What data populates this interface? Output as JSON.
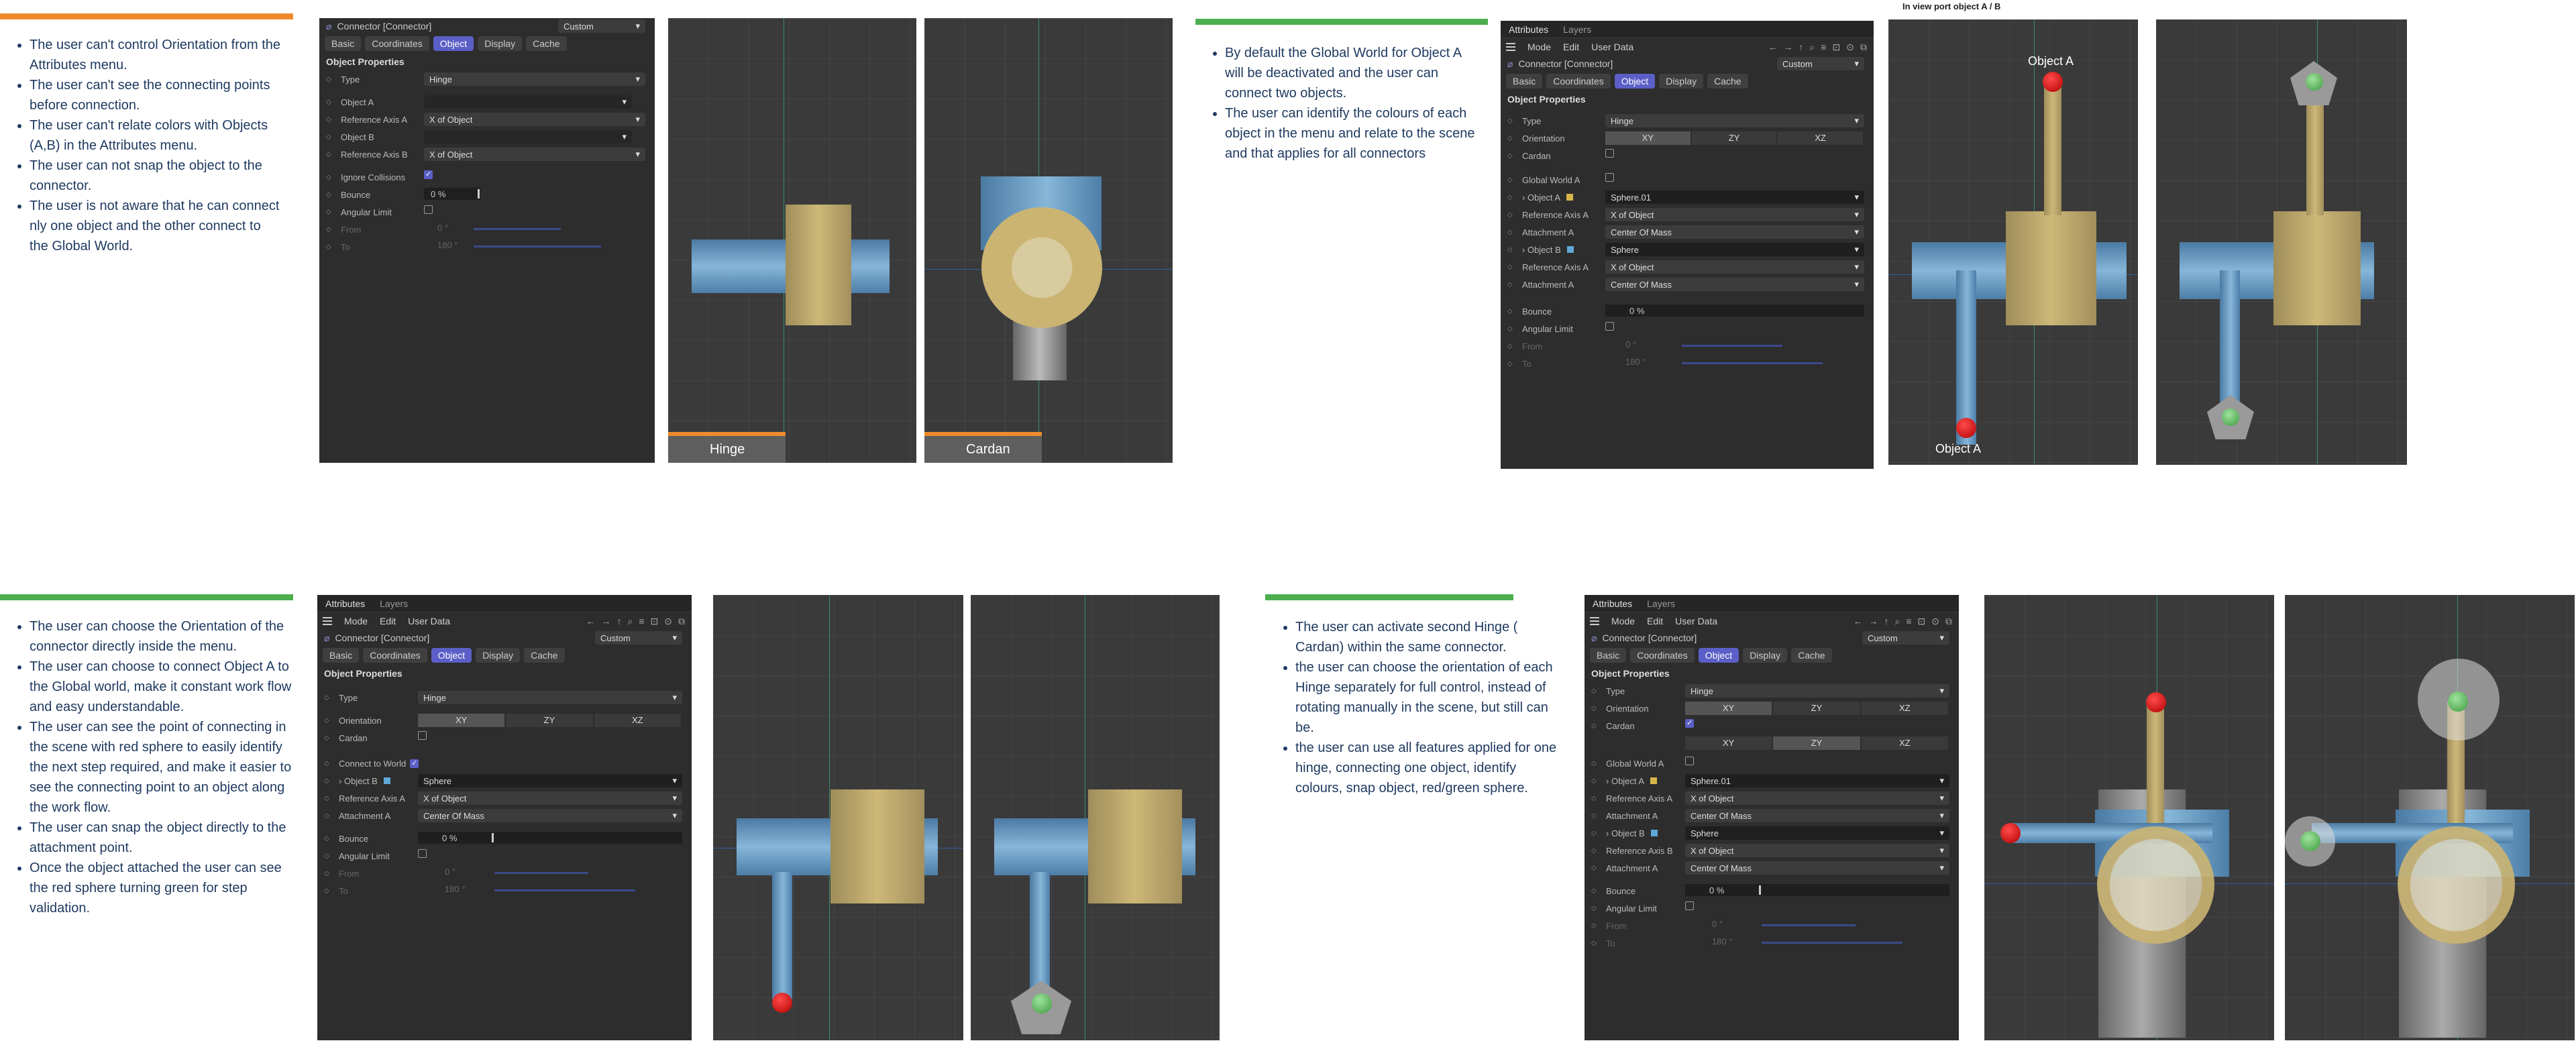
{
  "colors": {
    "orange": "#ef8a2c",
    "green": "#4cae4f",
    "panel": "#2d2d2d",
    "accent": "#5b5fc7"
  },
  "s1": {
    "notes": [
      "The user can't control Orientation from the Attributes menu.",
      "The user can't see the connecting points before connection.",
      "The user can't relate colors with Objects (A,B) in the Attributes menu.",
      "The user can not snap the object to the connector.",
      "The user is not aware that he can connect nly one object and the other connect to the Global World."
    ],
    "panel": {
      "title": "Connector [Connector]",
      "mode": "Custom",
      "tabs": [
        "Basic",
        "Coordinates",
        "Object",
        "Display",
        "Cache"
      ],
      "section": "Object Properties",
      "type_lbl": "Type",
      "type_val": "Hinge",
      "objA_lbl": "Object A",
      "refA_lbl": "Reference Axis A",
      "refA_val": "X of Object",
      "objB_lbl": "Object B",
      "refB_lbl": "Reference Axis B",
      "refB_val": "X of Object",
      "ignore_lbl": "Ignore Collisions",
      "bounce_lbl": "Bounce",
      "bounce_val": "0 %",
      "angular_lbl": "Angular Limit",
      "from_lbl": "From",
      "from_val": "0 °",
      "to_lbl": "To",
      "to_val": "180 °"
    },
    "vp1": "Hinge",
    "vp2": "Cardan"
  },
  "s2": {
    "notes": [
      "By default the Global World for Object A will be deactivated and the user can connect two objects.",
      "The user can identify the colours of each object in the menu and relate to the scene and that applies for all connectors"
    ],
    "heading": "In view port object A / B",
    "panel": {
      "tab1": "Attributes",
      "tab2": "Layers",
      "menu": [
        "Mode",
        "Edit",
        "User Data"
      ],
      "title": "Connector [Connector]",
      "mode": "Custom",
      "tabs": [
        "Basic",
        "Coordinates",
        "Object",
        "Display",
        "Cache"
      ],
      "section": "Object Properties",
      "type_lbl": "Type",
      "type_val": "Hinge",
      "orient_lbl": "Orientation",
      "orient": [
        "XY",
        "ZY",
        "XZ"
      ],
      "cardan_lbl": "Cardan",
      "gw_lbl": "Global World A",
      "objA_lbl": "Object A",
      "objA_val": "Sphere.01",
      "refA_lbl": "Reference Axis A",
      "refA_val": "X of Object",
      "attA_lbl": "Attachment A",
      "attA_val": "Center Of Mass",
      "objB_lbl": "Object B",
      "objB_val": "Sphere",
      "refB_lbl": "Reference Axis A",
      "refB_val": "X of Object",
      "attB_lbl": "Attachment A",
      "attB_val": "Center Of Mass",
      "bounce_lbl": "Bounce",
      "bounce_val": "0 %",
      "angular_lbl": "Angular Limit",
      "from_lbl": "From",
      "from_val": "0 °",
      "to_lbl": "To",
      "to_val": "180 °"
    },
    "vpA_top": "Object A",
    "vpA_bottom": "Object A"
  },
  "s3": {
    "notes": [
      "The user can choose the Orientation of the connector directly inside the menu.",
      "The user can choose to connect Object A to the Global world, make it constant work flow and easy understandable.",
      "The user can see the point of connecting in the scene with red sphere to easily identify the next step required, and make it easier to see the connecting point to an object along the work flow.",
      "The user can snap the object directly to the attachment point.",
      "Once the object attached the user can see the red sphere turning green for step validation."
    ],
    "panel": {
      "tab1": "Attributes",
      "tab2": "Layers",
      "menu": [
        "Mode",
        "Edit",
        "User Data"
      ],
      "title": "Connector [Connector]",
      "mode": "Custom",
      "tabs": [
        "Basic",
        "Coordinates",
        "Object",
        "Display",
        "Cache"
      ],
      "section": "Object Properties",
      "type_lbl": "Type",
      "type_val": "Hinge",
      "orient_lbl": "Orientation",
      "orient": [
        "XY",
        "ZY",
        "XZ"
      ],
      "cardan_lbl": "Cardan",
      "cw_lbl": "Connect to World",
      "objB_lbl": "Object B",
      "objB_val": "Sphere",
      "refA_lbl": "Reference Axis A",
      "refA_val": "X of Object",
      "attA_lbl": "Attachment A",
      "attA_val": "Center Of Mass",
      "bounce_lbl": "Bounce",
      "bounce_val": "0 %",
      "angular_lbl": "Angular Limit",
      "from_lbl": "From",
      "from_val": "0 °",
      "to_lbl": "To",
      "to_val": "180 °"
    }
  },
  "s4": {
    "notes": [
      "The user can activate second Hinge ( Cardan) within the same connector.",
      "the user can choose the orientation of each Hinge separately for full control, instead of rotating manually in the scene, but still can be.",
      "the user can use all features applied for one hinge, connecting one object, identify colours, snap object, red/green sphere."
    ],
    "panel": {
      "tab1": "Attributes",
      "tab2": "Layers",
      "menu": [
        "Mode",
        "Edit",
        "User Data"
      ],
      "title": "Connector [Connector]",
      "mode": "Custom",
      "tabs": [
        "Basic",
        "Coordinates",
        "Object",
        "Display",
        "Cache"
      ],
      "section": "Object Properties",
      "type_lbl": "Type",
      "type_val": "Hinge",
      "orient_lbl": "Orientation",
      "orient": [
        "XY",
        "ZY",
        "XZ"
      ],
      "cardan_lbl": "Cardan",
      "gw_lbl": "Global World A",
      "objA_lbl": "Object A",
      "objA_val": "Sphere.01",
      "refA_lbl": "Reference Axis A",
      "refA_val": "X of Object",
      "attA_lbl": "Attachment A",
      "attA_val": "Center Of Mass",
      "objB_lbl": "Object B",
      "objB_val": "Sphere",
      "refB_lbl": "Reference Axis B",
      "refB_val": "X of Object",
      "attB_lbl": "Attachment A",
      "attB_val": "Center Of Mass",
      "bounce_lbl": "Bounce",
      "bounce_val": "0 %",
      "angular_lbl": "Angular Limit",
      "from_lbl": "From",
      "from_val": "0 °",
      "to_lbl": "To",
      "to_val": "180 °"
    }
  }
}
